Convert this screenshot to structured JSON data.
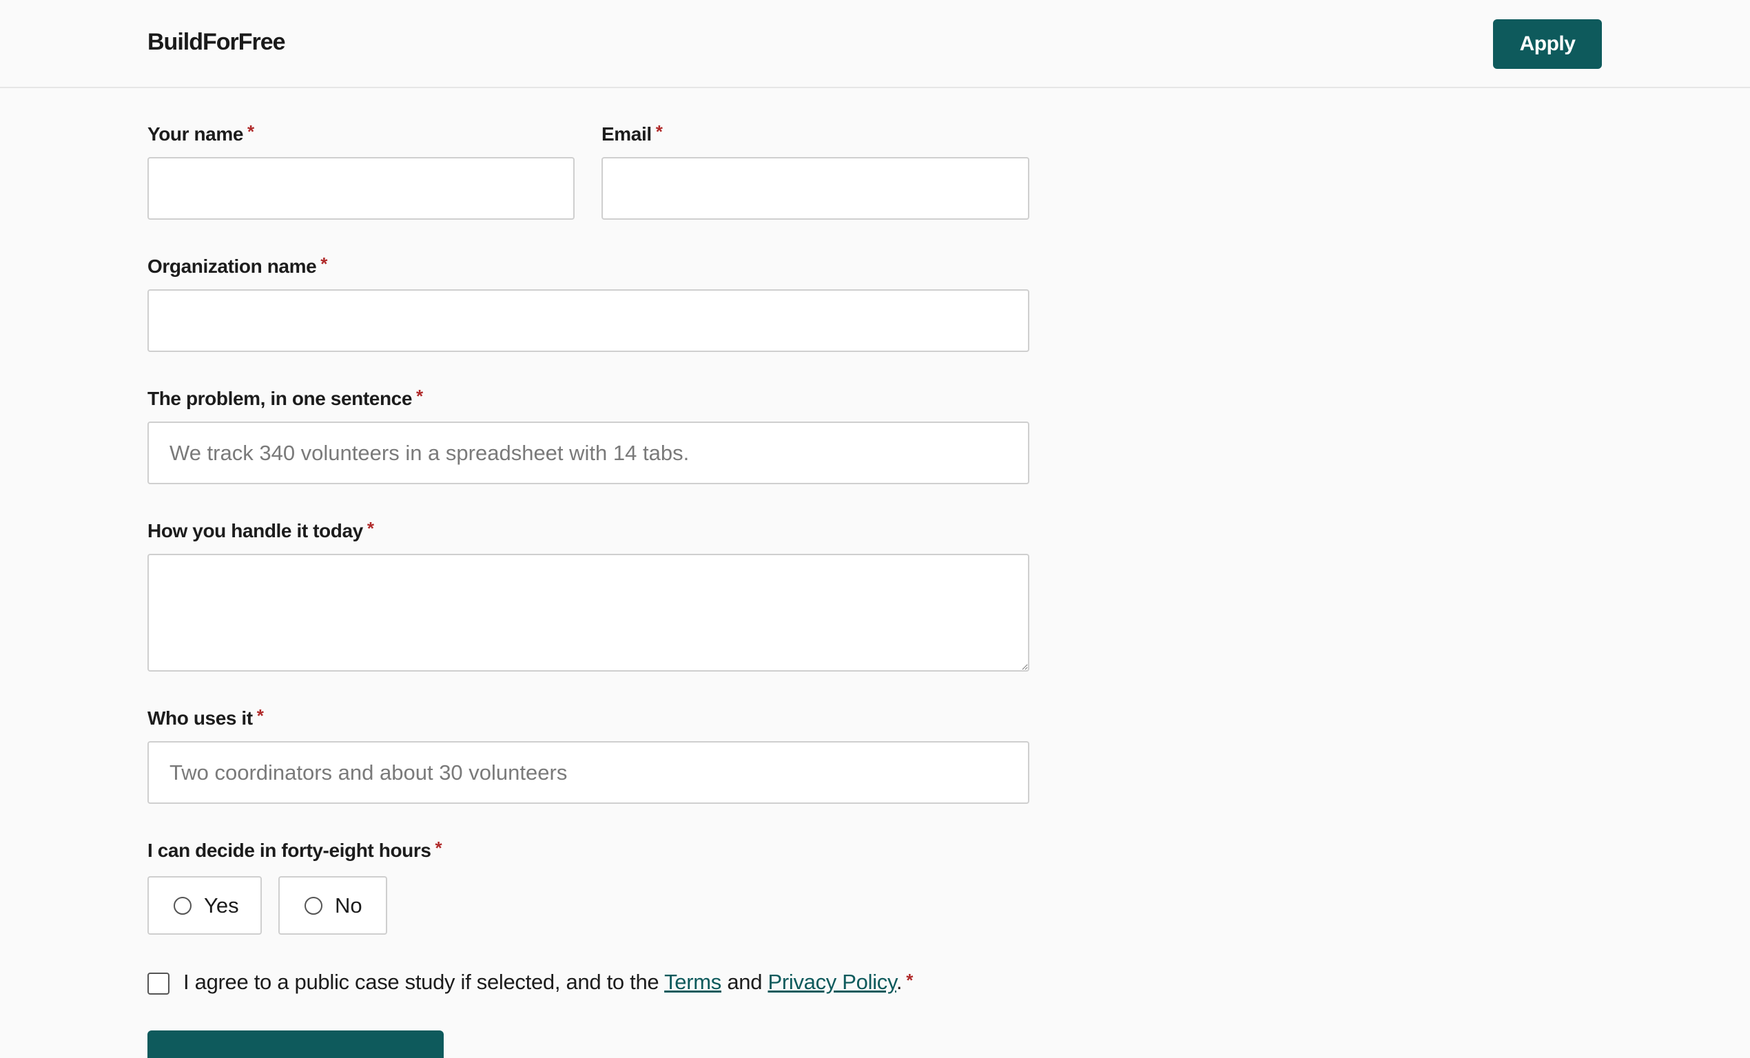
{
  "header": {
    "brand": "BuildForFree",
    "apply_label": "Apply"
  },
  "form": {
    "required_mark": "*",
    "name": {
      "label": "Your name",
      "value": ""
    },
    "email": {
      "label": "Email",
      "value": ""
    },
    "organization": {
      "label": "Organization name",
      "value": ""
    },
    "problem": {
      "label": "The problem, in one sentence",
      "placeholder": "We track 340 volunteers in a spreadsheet with 14 tabs."
    },
    "handle": {
      "label": "How you handle it today",
      "value": ""
    },
    "users": {
      "label": "Who uses it",
      "placeholder": "Two coordinators and about 30 volunteers"
    },
    "decide": {
      "label": "I can decide in forty-eight hours",
      "options": [
        "Yes",
        "No"
      ]
    },
    "agree": {
      "text_before": "I agree to a public case study if selected, and to the ",
      "terms": "Terms",
      "and": " and ",
      "privacy": "Privacy Policy",
      "end": ".",
      "checked": false
    }
  },
  "colors": {
    "accent": "#0e5a5c",
    "required": "#b02a2a"
  }
}
